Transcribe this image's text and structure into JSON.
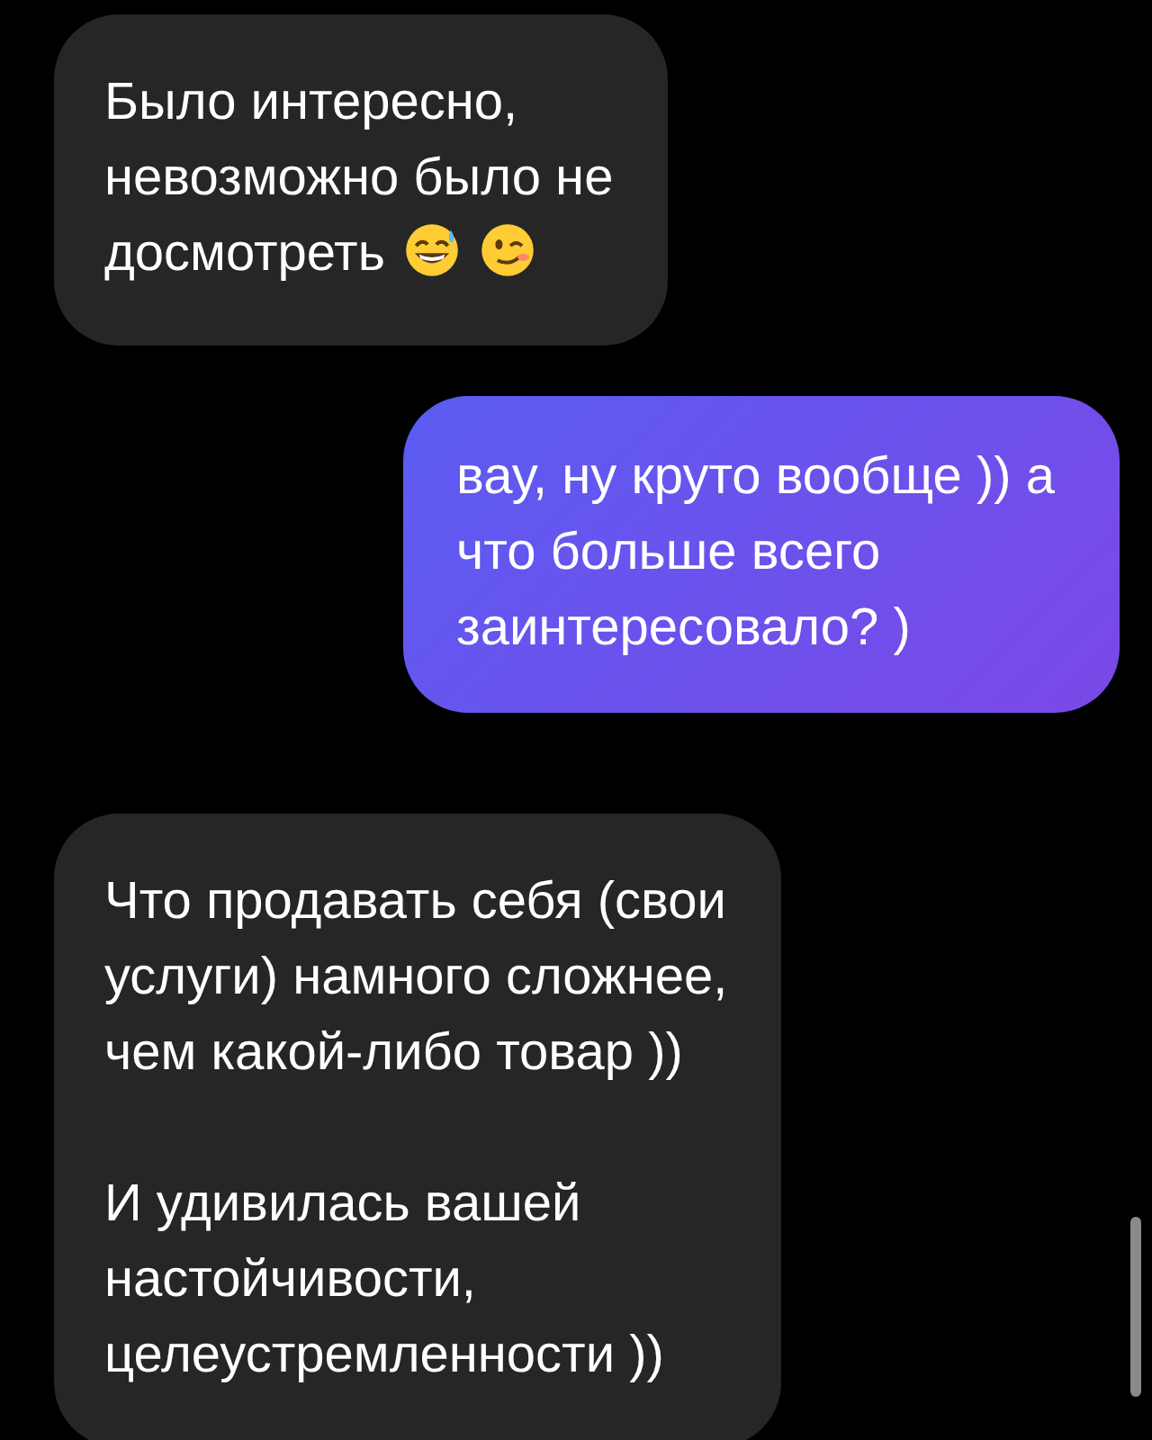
{
  "messages": [
    {
      "kind": "incoming",
      "paragraphs": [
        "Было интересно,\nневозможно было не\nдосмотреть"
      ],
      "emoji": [
        {
          "kind": "sweat-smile"
        },
        {
          "kind": "wink"
        }
      ]
    },
    {
      "kind": "outgoing",
      "paragraphs": [
        "вау, ну круто вообще )) а\nчто больше всего\nзаинтересовало? )"
      ]
    },
    {
      "kind": "incoming",
      "paragraphs": [
        "Что продавать себя (свои\nуслуги) намного сложнее,\nчем какой-либо товар ))",
        "И удивилась вашей\nнастойчивости,\nцелеустремленности ))"
      ]
    }
  ]
}
